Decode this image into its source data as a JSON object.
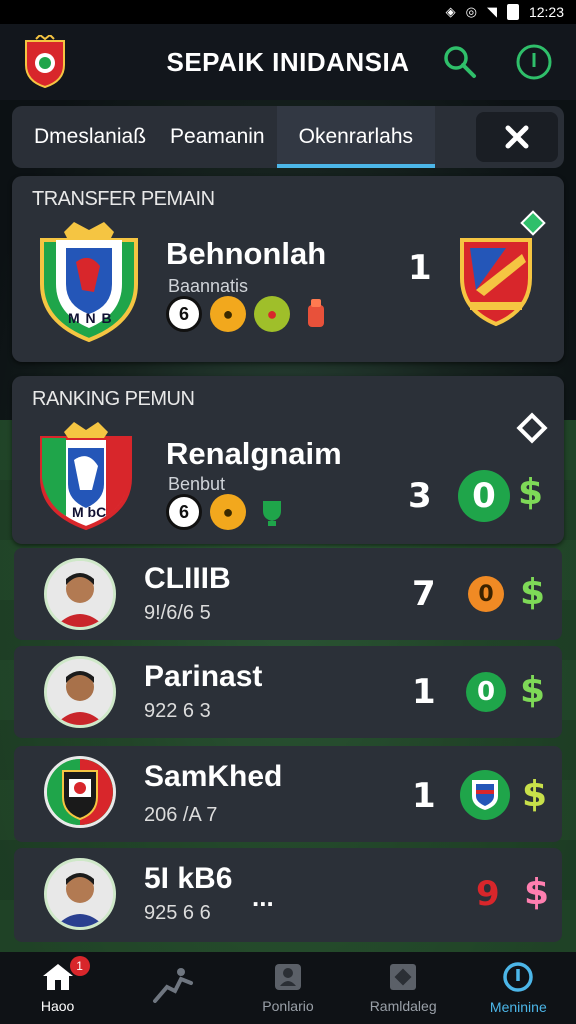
{
  "status_bar": {
    "time": "12:23"
  },
  "header": {
    "title": "SEPAIK INIDANSIA"
  },
  "tabs": [
    {
      "label": "Dmeslaniaß"
    },
    {
      "label": "Peamanin"
    },
    {
      "label": "Okenrarlahs",
      "active": true
    }
  ],
  "transfer": {
    "section_title": "TRANSFER PEMAIN",
    "team_name": "Behnonlah",
    "team_sub": "Baannatis",
    "crest_text": "M N B",
    "badges": [
      "6",
      "",
      "",
      ""
    ],
    "value": "1"
  },
  "ranking": {
    "section_title": "RANKING PEMUN",
    "team_name": "Renalgnaim",
    "team_sub": "Benbut",
    "crest_text": "M bC",
    "badges": [
      "6",
      "",
      ""
    ],
    "value": "3",
    "score": "0",
    "dollar": "$"
  },
  "players": [
    {
      "name": "CLIIIB",
      "sub": "9!/6/6 5",
      "value": "7",
      "score": "0",
      "score_color": "#f08a24",
      "dollar": "$",
      "dollar_color": "#7ed957"
    },
    {
      "name": "Parinast",
      "sub": "922 6 3",
      "value": "1",
      "score": "0",
      "score_color": "#1fa54a",
      "dollar": "$",
      "dollar_color": "#7ed957"
    },
    {
      "name": "SamKhed",
      "sub": "206 /A 7",
      "value": "1",
      "score": "",
      "score_color": "#1fa54a",
      "dollar": "$",
      "dollar_color": "#c8e04a"
    },
    {
      "name": "5I kB6",
      "sub": "925 6 6",
      "value": "9",
      "score": "",
      "score_color": "",
      "dollar": "$",
      "dollar_color": "#ff7fb0",
      "value_color": "#d8262b",
      "more": "..."
    }
  ],
  "bottom_nav": [
    {
      "label": "Haoo",
      "badge": "1"
    },
    {
      "label": ""
    },
    {
      "label": "Ponlario"
    },
    {
      "label": "Ramldaleg"
    },
    {
      "label": "Meninine"
    }
  ],
  "colors": {
    "accent": "#4cb6e8",
    "green": "#1fa54a",
    "orange": "#f08a24",
    "red": "#d8262b",
    "card": "#2b3038"
  }
}
